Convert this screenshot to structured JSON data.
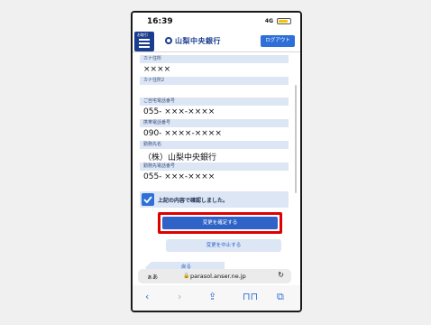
{
  "status_bar": {
    "time": "16:39",
    "signal": "4G"
  },
  "header": {
    "menu_label": "お取引",
    "bank_name": "山梨中央銀行",
    "logout_label": "ログアウト"
  },
  "fields": [
    {
      "label": "カナ住所",
      "value": "××××"
    },
    {
      "label": "カナ住所2",
      "value": ""
    },
    {
      "label": "ご自宅電話番号",
      "value": "055- ×××-××××"
    },
    {
      "label": "携帯電話番号",
      "value": "090- ××××-××××"
    },
    {
      "label": "勤務先名",
      "value": "（株）山梨中央銀行"
    },
    {
      "label": "勤務先電話番号",
      "value": "055- ×××-××××"
    }
  ],
  "confirm": {
    "text": "上記の内容で確認しました。",
    "checked": true
  },
  "buttons": {
    "confirm_change": "変更を確定する",
    "cancel_change": "変更を中止する",
    "back": "戻る"
  },
  "browser": {
    "text_size": "ぁあ",
    "url": "parasol.anser.ne.jp"
  },
  "icons": [
    "menu-icon",
    "checkmark-icon",
    "lock-icon",
    "reload-icon",
    "back-arrow-icon",
    "forward-arrow-icon",
    "share-icon",
    "bookmarks-icon",
    "tabs-icon"
  ],
  "colors": {
    "primary": "#2f63c8",
    "brand": "#1a3d8f",
    "highlight": "#e00000",
    "field_bg": "#dce6f5"
  }
}
